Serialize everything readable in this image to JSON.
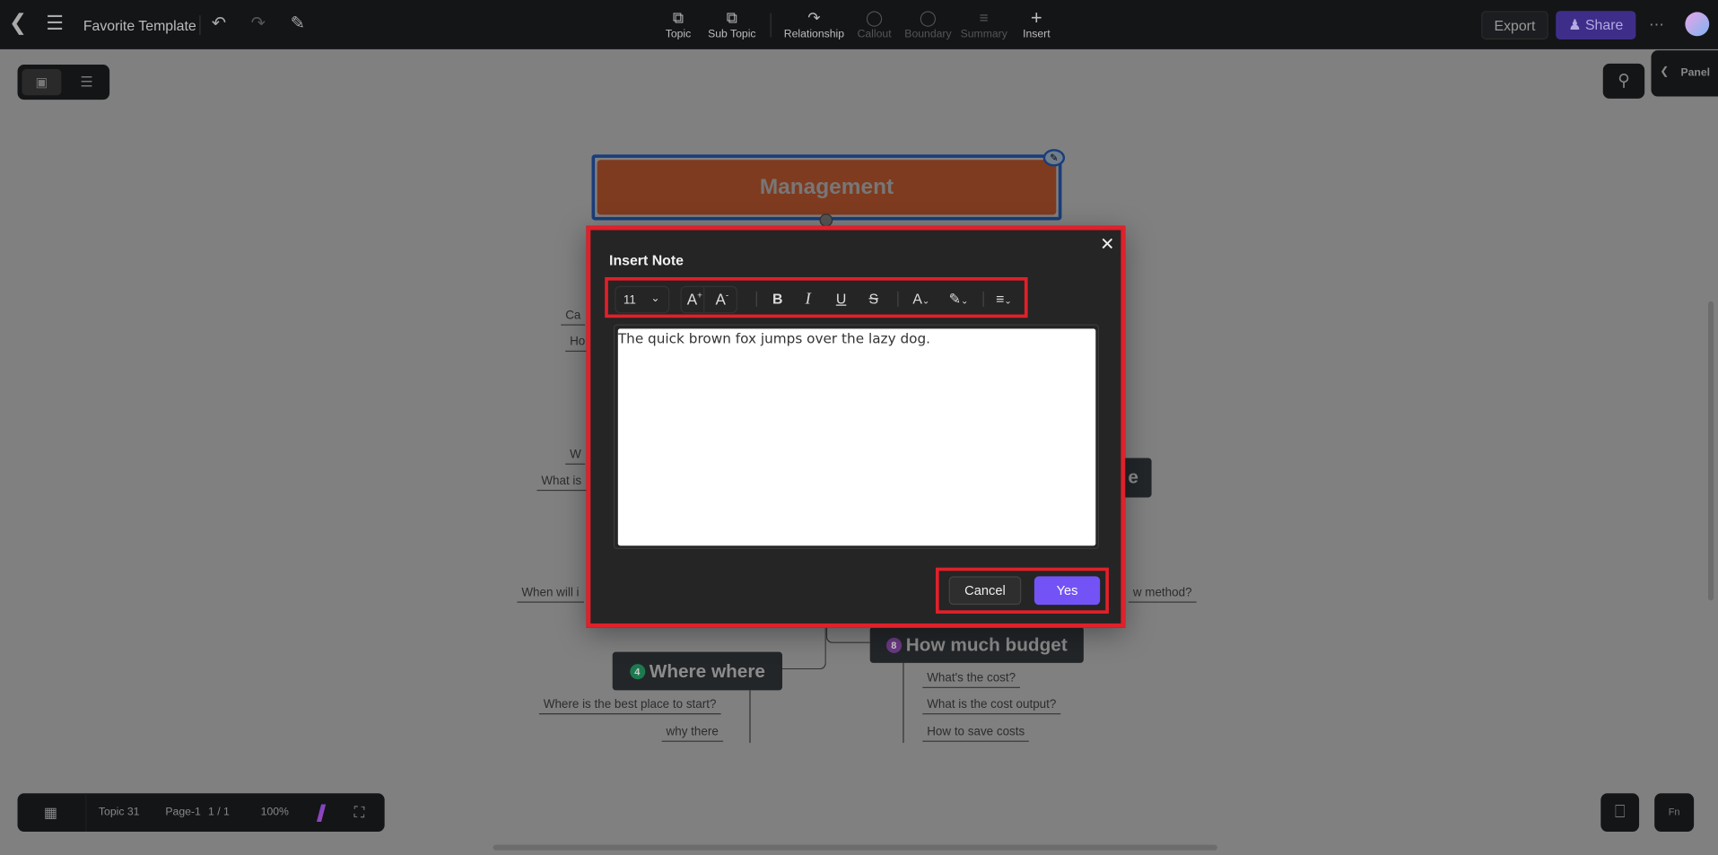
{
  "topbar": {
    "title": "Favorite Template",
    "tools": [
      {
        "label": "Topic",
        "icon": "topic-icon",
        "enabled": true
      },
      {
        "label": "Sub Topic",
        "icon": "subtopic-icon",
        "enabled": true
      },
      {
        "label": "Relationship",
        "icon": "relationship-icon",
        "enabled": true
      },
      {
        "label": "Callout",
        "icon": "callout-icon",
        "enabled": false
      },
      {
        "label": "Boundary",
        "icon": "boundary-icon",
        "enabled": false
      },
      {
        "label": "Summary",
        "icon": "summary-icon",
        "enabled": false
      },
      {
        "label": "Insert",
        "icon": "plus-icon",
        "enabled": true
      }
    ],
    "export_label": "Export",
    "share_label": "Share",
    "share_color": "#4b35a8"
  },
  "side_panel_label": "Panel",
  "canvas": {
    "root_topic": "Management",
    "root_color": "#7f3b1f",
    "nodes": [
      {
        "label": "Where where",
        "badge": "4",
        "badge_color": "#1c7a4e"
      },
      {
        "label": "How much budget",
        "badge": "8",
        "badge_color": "#6b3a85"
      },
      {
        "label": "e"
      }
    ],
    "texts": [
      "Ca",
      "Ho",
      "W",
      "What is",
      "When will i",
      "w method?",
      "?",
      "Where is the best place to start?",
      "why there",
      "What's the cost?",
      "What is the cost output?",
      "How to save costs"
    ]
  },
  "dialog": {
    "title": "Insert Note",
    "font_size": "11",
    "content": "The quick brown fox jumps over the lazy dog.",
    "cancel_label": "Cancel",
    "yes_label": "Yes",
    "yes_color": "#7353f5",
    "highlight_color": "#e0202a"
  },
  "statusbar": {
    "topic": "Topic 31",
    "page": "Page-1",
    "page_count": "1 / 1",
    "zoom": "100%"
  }
}
